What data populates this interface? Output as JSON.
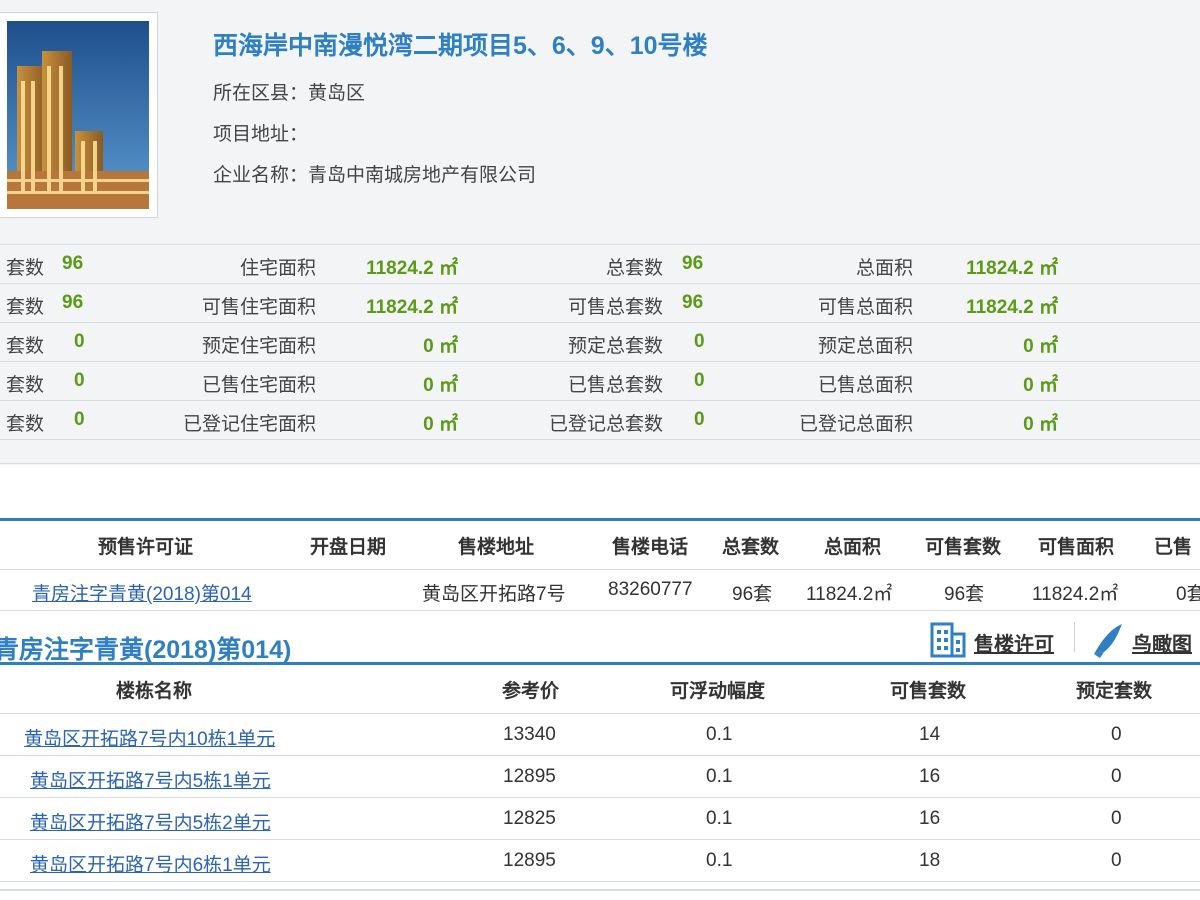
{
  "project": {
    "title": "西海岸中南漫悦湾二期项目5、6、9、10号楼",
    "district": "所在区县：黄岛区",
    "address": "项目地址：",
    "company": "企业名称：青岛中南城房地产有限公司"
  },
  "stats": [
    {
      "c1_label": "套数",
      "c1_value": "96",
      "c2_label": "住宅面积",
      "c2_value": "11824.2 ㎡",
      "c3_label": "总套数",
      "c3_value": "96",
      "c4_label": "总面积",
      "c4_value": "11824.2 ㎡"
    },
    {
      "c1_label": "套数",
      "c1_value": "96",
      "c2_label": "可售住宅面积",
      "c2_value": "11824.2 ㎡",
      "c3_label": "可售总套数",
      "c3_value": "96",
      "c4_label": "可售总面积",
      "c4_value": "11824.2 ㎡"
    },
    {
      "c1_label": "套数",
      "c1_value": "0",
      "c2_label": "预定住宅面积",
      "c2_value": "0 ㎡",
      "c3_label": "预定总套数",
      "c3_value": "0",
      "c4_label": "预定总面积",
      "c4_value": "0 ㎡"
    },
    {
      "c1_label": "套数",
      "c1_value": "0",
      "c2_label": "已售住宅面积",
      "c2_value": "0 ㎡",
      "c3_label": "已售总套数",
      "c3_value": "0",
      "c4_label": "已售总面积",
      "c4_value": "0 ㎡"
    },
    {
      "c1_label": "套数",
      "c1_value": "0",
      "c2_label": "已登记住宅面积",
      "c2_value": "0 ㎡",
      "c3_label": "已登记总套数",
      "c3_value": "0",
      "c4_label": "已登记总面积",
      "c4_value": "0 ㎡"
    }
  ],
  "permit_table": {
    "headers": [
      "预售许可证",
      "开盘日期",
      "售楼地址",
      "售楼电话",
      "总套数",
      "总面积",
      "可售套数",
      "可售面积",
      "已售"
    ],
    "row": [
      "青房注字青黄(2018)第014",
      "",
      "黄岛区开拓路7号",
      "83260777",
      "96套",
      "11824.2㎡",
      "96套",
      "11824.2㎡",
      "0套"
    ]
  },
  "section": {
    "title": "青房注字青黄(2018)第014)",
    "sales_permit_label": "售楼许可",
    "aerial_label": "鸟瞰图"
  },
  "building_table": {
    "headers": [
      "楼栋名称",
      "参考价",
      "可浮动幅度",
      "可售套数",
      "预定套数"
    ],
    "rows": [
      [
        "黄岛区开拓路7号内10栋1单元",
        "13340",
        "0.1",
        "14",
        "0"
      ],
      [
        "黄岛区开拓路7号内5栋1单元",
        "12895",
        "0.1",
        "16",
        "0"
      ],
      [
        "黄岛区开拓路7号内5栋2单元",
        "12825",
        "0.1",
        "16",
        "0"
      ],
      [
        "黄岛区开拓路7号内6栋1单元",
        "12895",
        "0.1",
        "18",
        "0"
      ]
    ]
  },
  "colors": {
    "accent": "#2f7fc4",
    "value_green": "#5a9a16",
    "link": "#2a63b8"
  },
  "icons": {
    "sales_permit": "building-icon",
    "aerial": "bird-icon"
  }
}
